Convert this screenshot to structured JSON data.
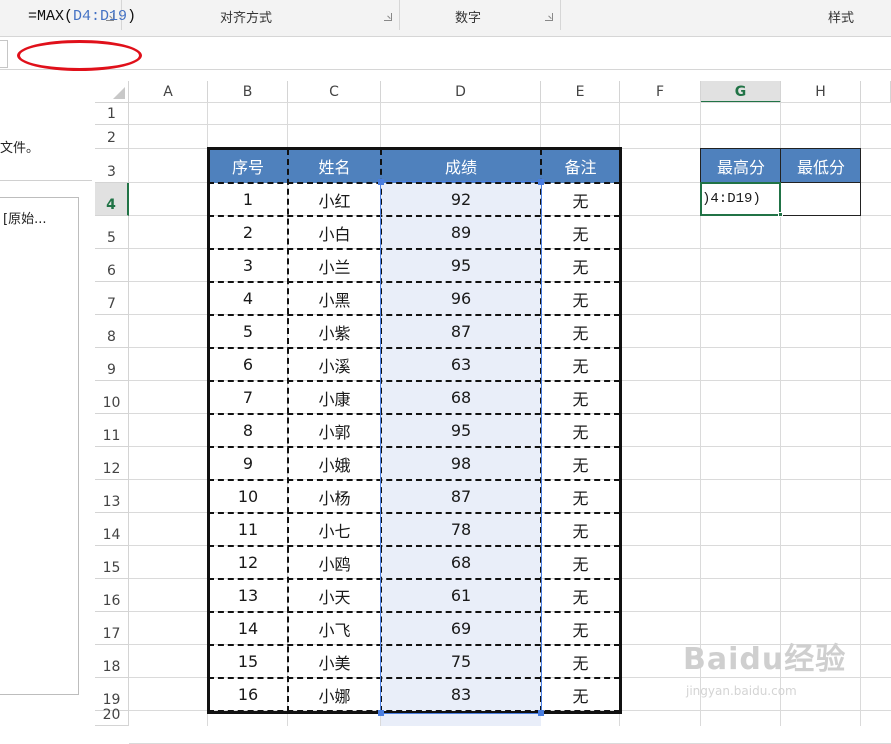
{
  "ribbon": {
    "groups": [
      "对齐方式",
      "数字",
      "样式"
    ]
  },
  "formula_bar": {
    "prefix": "=MAX(",
    "ref": "D4:D19",
    "suffix": ")"
  },
  "left_pane": {
    "text": "文件。",
    "item": "[原始..."
  },
  "columns": [
    "A",
    "B",
    "C",
    "D",
    "E",
    "F",
    "G",
    "H"
  ],
  "rows": [
    "1",
    "2",
    "3",
    "4",
    "5",
    "6",
    "7",
    "8",
    "9",
    "10",
    "11",
    "12",
    "13",
    "14",
    "15",
    "16",
    "17",
    "18",
    "19",
    "20"
  ],
  "table": {
    "headers": [
      "序号",
      "姓名",
      "成绩",
      "备注"
    ],
    "rows": [
      [
        "1",
        "小红",
        "92",
        "无"
      ],
      [
        "2",
        "小白",
        "89",
        "无"
      ],
      [
        "3",
        "小兰",
        "95",
        "无"
      ],
      [
        "4",
        "小黑",
        "96",
        "无"
      ],
      [
        "5",
        "小紫",
        "87",
        "无"
      ],
      [
        "6",
        "小溪",
        "63",
        "无"
      ],
      [
        "7",
        "小康",
        "68",
        "无"
      ],
      [
        "8",
        "小郭",
        "95",
        "无"
      ],
      [
        "9",
        "小娥",
        "98",
        "无"
      ],
      [
        "10",
        "小杨",
        "87",
        "无"
      ],
      [
        "11",
        "小七",
        "78",
        "无"
      ],
      [
        "12",
        "小鸥",
        "68",
        "无"
      ],
      [
        "13",
        "小天",
        "61",
        "无"
      ],
      [
        "14",
        "小飞",
        "69",
        "无"
      ],
      [
        "15",
        "小美",
        "75",
        "无"
      ],
      [
        "16",
        "小娜",
        "83",
        "无"
      ]
    ]
  },
  "summary": {
    "headers": [
      "最高分",
      "最低分"
    ],
    "g4_display": ")4:D19)",
    "h4": ""
  },
  "watermark": {
    "brand": "Baidu经验",
    "url": "jingyan.baidu.com"
  },
  "colors": {
    "header_blue": "#4f81bd",
    "selection_green": "#217346",
    "ref_blue": "#4472c4",
    "oval_red": "#e0101a"
  }
}
